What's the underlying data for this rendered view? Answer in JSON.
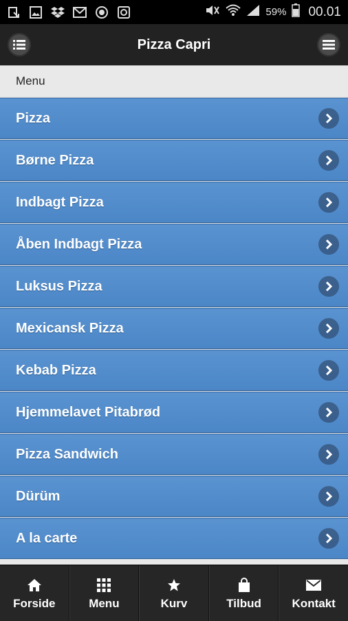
{
  "status_bar": {
    "battery": "59%",
    "time": "00.01"
  },
  "header": {
    "title": "Pizza Capri"
  },
  "section": {
    "title": "Menu"
  },
  "menu_items": [
    {
      "label": "Pizza"
    },
    {
      "label": "Børne Pizza"
    },
    {
      "label": "Indbagt Pizza"
    },
    {
      "label": "Åben Indbagt Pizza"
    },
    {
      "label": "Luksus Pizza"
    },
    {
      "label": "Mexicansk Pizza"
    },
    {
      "label": "Kebab Pizza"
    },
    {
      "label": "Hjemmelavet Pitabrød"
    },
    {
      "label": "Pizza Sandwich"
    },
    {
      "label": "Dürüm"
    },
    {
      "label": "A la carte"
    }
  ],
  "tabbar": {
    "items": [
      {
        "label": "Forside",
        "icon": "home-icon"
      },
      {
        "label": "Menu",
        "icon": "grid-icon"
      },
      {
        "label": "Kurv",
        "icon": "star-icon"
      },
      {
        "label": "Tilbud",
        "icon": "bag-icon"
      },
      {
        "label": "Kontakt",
        "icon": "mail-icon"
      }
    ]
  },
  "colors": {
    "list_item": "#4b86c7",
    "header": "#222222",
    "tabbar": "#262626"
  }
}
